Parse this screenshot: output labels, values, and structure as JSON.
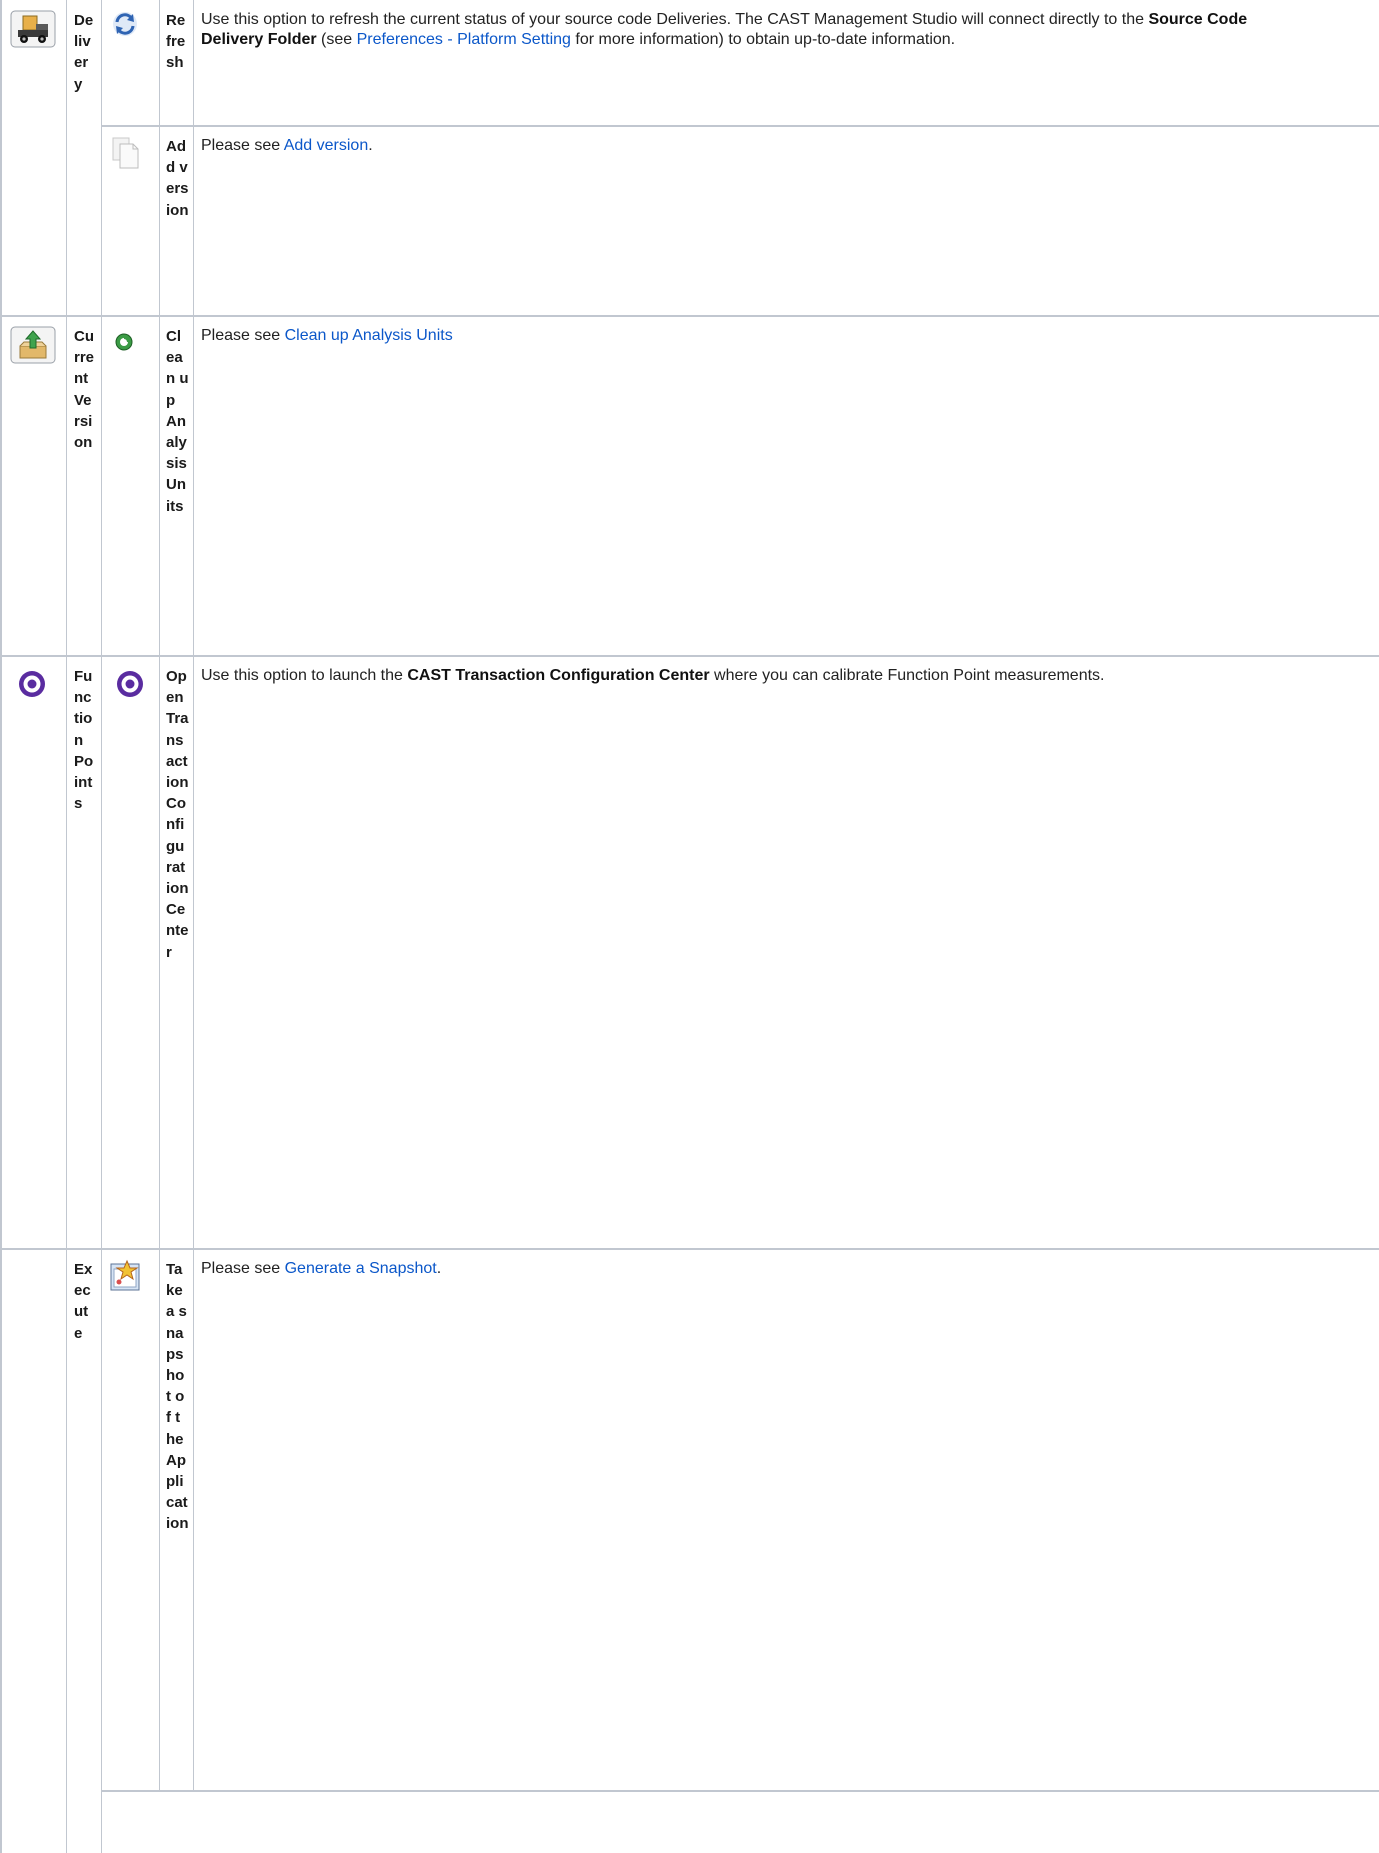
{
  "rows": [
    {
      "category": "Delivery",
      "actions": [
        {
          "action": "Refresh",
          "description": {
            "line1_a": "Use this option to refresh the current status of your source code Deliveries. The CAST Management Studio will connect directly to the ",
            "line1_bold": "Source Code",
            "line2_bold": "Delivery Folder",
            "line2_a": " (see ",
            "line2_link": "Preferences - Platform Setting",
            "line2_b": " for more information) to obtain up-to-date information."
          }
        },
        {
          "action": "Add version",
          "description": {
            "prefix": "Please see ",
            "link": "Add version",
            "suffix": "."
          }
        }
      ]
    },
    {
      "category": "Current Version",
      "actions": [
        {
          "action": "Clean up Analysis Units",
          "description": {
            "prefix": "Please see ",
            "link": "Clean up Analysis Units"
          }
        }
      ]
    },
    {
      "category": "Function Points",
      "actions": [
        {
          "action": "Open Transaction Configuration Center",
          "description": {
            "prefix": "Use this option to launch the ",
            "bold": "CAST Transaction Configuration Center",
            "suffix": " where you can calibrate Function Point measurements."
          }
        }
      ]
    },
    {
      "category": "Execute",
      "actions": [
        {
          "action": "Take a snapshot of the Application",
          "description": {
            "prefix": "Please see ",
            "link": "Generate a Snapshot",
            "suffix": "."
          }
        }
      ]
    }
  ],
  "icons": {
    "delivery": "delivery-truck-icon",
    "refresh": "refresh-icon",
    "add_version": "add-version-icon",
    "current_version": "current-version-icon",
    "clean_up": "clean-up-icon",
    "function_points": "target-icon",
    "open_tcc": "target-icon",
    "snapshot": "snapshot-icon"
  },
  "colors": {
    "link": "#0b57c9",
    "border": "#c1c7d0",
    "target": "#5a2ca0"
  }
}
